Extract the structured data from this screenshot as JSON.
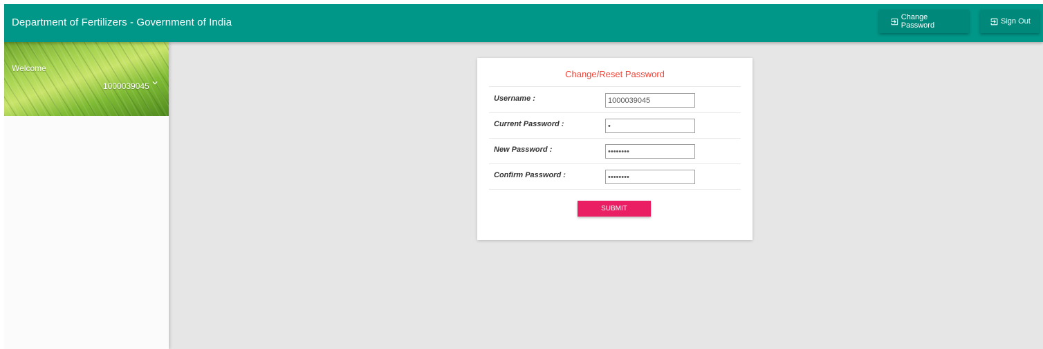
{
  "header": {
    "title": "Department of Fertilizers - Government of India",
    "change_password_label": "Change Password",
    "sign_out_label": "Sign Out"
  },
  "sidebar": {
    "welcome_label": "Welcome",
    "user_id": "1000039045",
    "icons": {
      "user_menu": "chevron-down-icon"
    }
  },
  "form": {
    "title": "Change/Reset Password",
    "fields": [
      {
        "label": "Username :",
        "value": "1000039045",
        "type": "text"
      },
      {
        "label": "Current Password :",
        "value": "•",
        "type": "password"
      },
      {
        "label": "New Password :",
        "value": "••••••••",
        "type": "password"
      },
      {
        "label": "Confirm Password :",
        "value": "••••••••",
        "type": "password"
      }
    ],
    "submit_label": "SUBMIT"
  },
  "colors": {
    "topbar": "#009688",
    "topbar_button": "#00897b",
    "form_title": "#f44336",
    "submit": "#e91e63",
    "content_bg": "#e6e6e6"
  },
  "icons": {
    "change_password": "exit-to-app-icon",
    "sign_out": "exit-to-app-icon"
  }
}
